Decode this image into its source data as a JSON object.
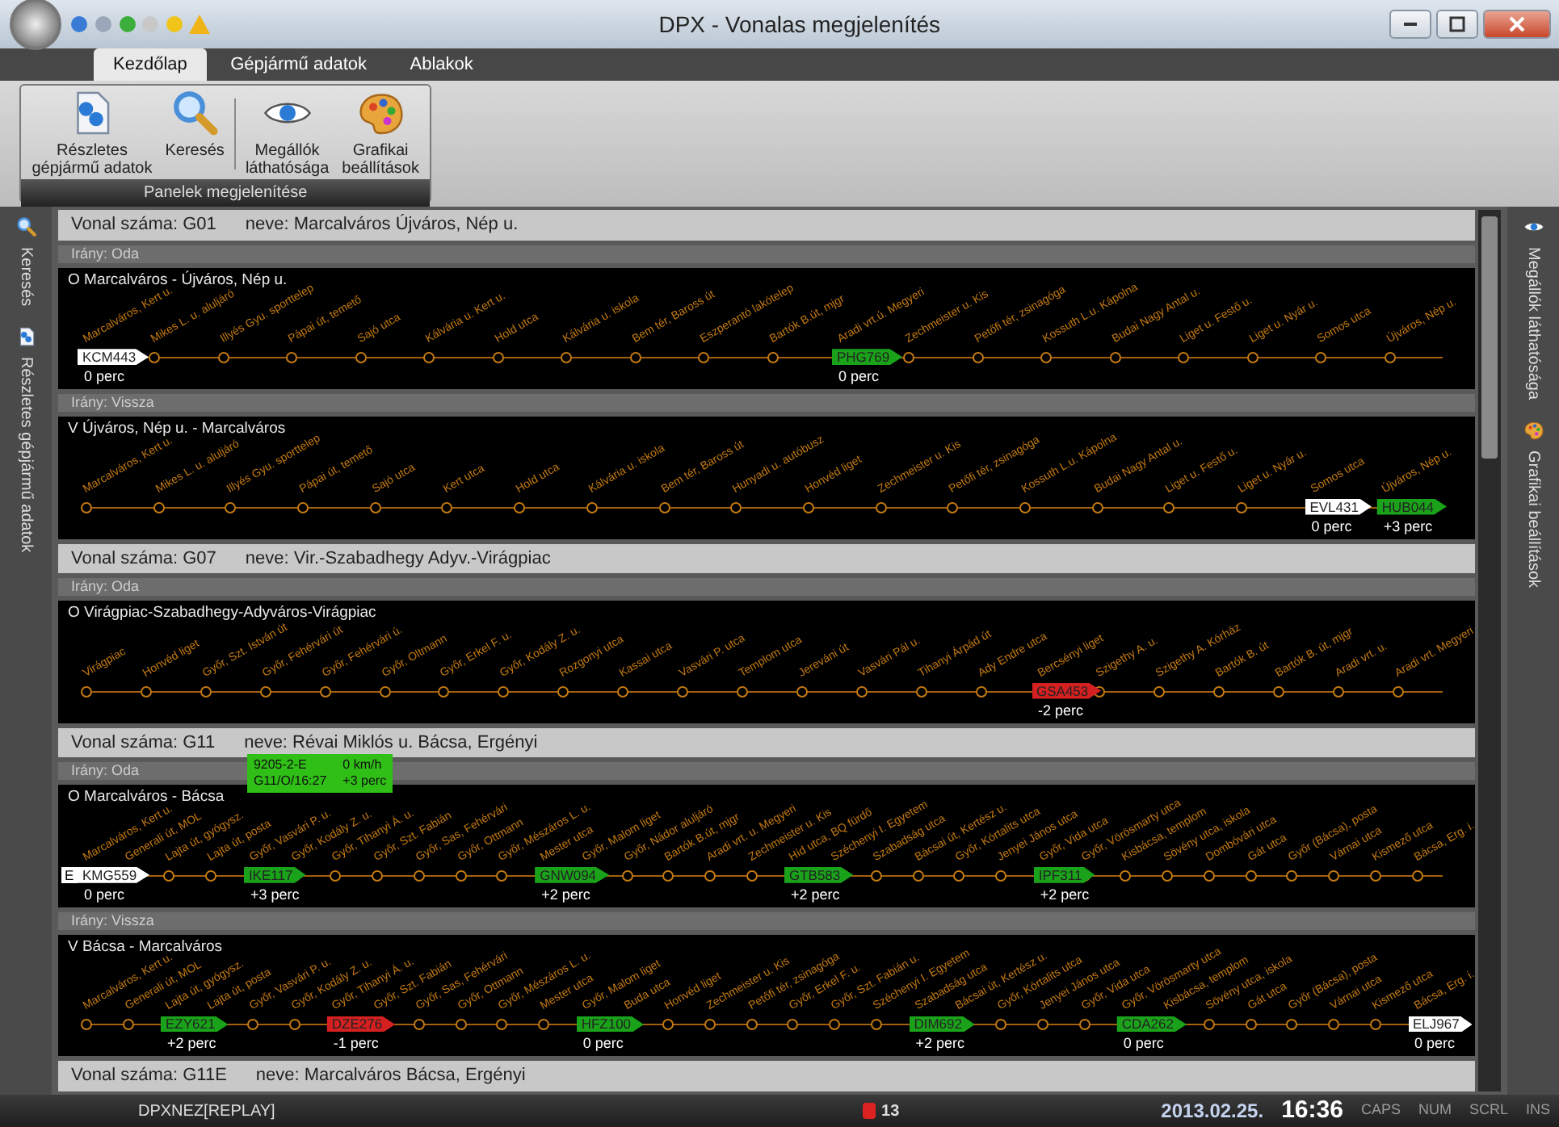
{
  "window": {
    "title": "DPX - Vonalas megjelenítés"
  },
  "ribbon": {
    "tabs": [
      {
        "label": "Kezdőlap",
        "selected": true
      },
      {
        "label": "Gépjármű adatok",
        "selected": false
      },
      {
        "label": "Ablakok",
        "selected": false
      }
    ],
    "buttons": [
      {
        "kind": "details",
        "label": "Részletes\ngépjármű adatok"
      },
      {
        "kind": "search",
        "label": "Keresés"
      },
      {
        "kind": "eye",
        "label": "Megállók\nláthatósága"
      },
      {
        "kind": "palette",
        "label": "Grafikai\nbeállítások"
      }
    ],
    "group_label": "Panelek megjelenítése"
  },
  "left_sidebar": [
    {
      "kind": "search",
      "label": "Keresés"
    },
    {
      "kind": "details",
      "label": "Részletes gépjármű adatok"
    }
  ],
  "right_sidebar": [
    {
      "kind": "eye",
      "label": "Megállók láthatósága"
    },
    {
      "kind": "palette",
      "label": "Grafikai beállítások"
    }
  ],
  "lines": [
    {
      "number": "Vonal száma: G01",
      "name": "neve: Marcalváros Újváros, Nép u.",
      "directions": [
        {
          "label": "Irány: Oda",
          "title": "O Marcalváros - Újváros, Nép u.",
          "stops": [
            {
              "name": "Marcalváros, Kert u.",
              "vehicle": {
                "plate": "KCM443",
                "color": "#ffffff",
                "delay": "0 perc"
              }
            },
            {
              "name": "Mikes L. u. aluljáró"
            },
            {
              "name": "Illyés Gyu. sporttelep"
            },
            {
              "name": "Pápai út, temető"
            },
            {
              "name": "Sajó utca"
            },
            {
              "name": "Kálvária u. Kert u."
            },
            {
              "name": "Hold utca"
            },
            {
              "name": "Kálvária u. iskola"
            },
            {
              "name": "Bem tér, Baross út"
            },
            {
              "name": "Eszperantó lakótelep"
            },
            {
              "name": "Bartók B.út, mjgr"
            },
            {
              "name": "Aradi vrt.ú. Megyeri",
              "vehicle": {
                "plate": "PHG769",
                "color": "#1aa31a",
                "delay": "0 perc"
              }
            },
            {
              "name": "Zechmeister u. Kis"
            },
            {
              "name": "Petőfi tér, zsinagóga"
            },
            {
              "name": "Kossuth L.u. Kápolna"
            },
            {
              "name": "Budai Nagy Antal u."
            },
            {
              "name": "Liget u. Festő u."
            },
            {
              "name": "Liget u. Nyár u."
            },
            {
              "name": "Somos utca"
            },
            {
              "name": "Újváros, Nép u."
            }
          ]
        },
        {
          "label": "Irány: Vissza",
          "title": "V Újváros, Nép u. - Marcalváros",
          "stops": [
            {
              "name": "Marcalváros, Kert u."
            },
            {
              "name": "Mikes L. u. aluljáró"
            },
            {
              "name": "Illyés Gyu. sporttelep"
            },
            {
              "name": "Pápai út, temető"
            },
            {
              "name": "Sajó utca"
            },
            {
              "name": "Kert utca"
            },
            {
              "name": "Hold utca"
            },
            {
              "name": "Kálvária u. iskola"
            },
            {
              "name": "Bem tér, Baross út"
            },
            {
              "name": "Hunyadi u. autóbusz"
            },
            {
              "name": "Honvéd liget"
            },
            {
              "name": "Zechmeister u. Kis"
            },
            {
              "name": "Petőfi tér, zsinagóga"
            },
            {
              "name": "Kossuth L.u. Kápolna"
            },
            {
              "name": "Budai Nagy Antal u."
            },
            {
              "name": "Liget u. Festő u."
            },
            {
              "name": "Liget u. Nyár u."
            },
            {
              "name": "Somos utca",
              "vehicle": {
                "plate": "EVL431",
                "color": "#ffffff",
                "delay": "0 perc"
              }
            },
            {
              "name": "Újváros, Nép u.",
              "vehicle": {
                "plate": "HUB044",
                "color": "#1aa31a",
                "delay": "+3 perc"
              }
            }
          ]
        }
      ]
    },
    {
      "number": "Vonal száma: G07",
      "name": "neve: Vir.-Szabadhegy Adyv.-Virágpiac",
      "directions": [
        {
          "label": "Irány: Oda",
          "title": "O Virágpiac-Szabadhegy-Adyváros-Virágpiac",
          "stops": [
            {
              "name": "Virágpiac"
            },
            {
              "name": "Honvéd liget"
            },
            {
              "name": "Győr, Szt. István út"
            },
            {
              "name": "Győr, Fehérvári út"
            },
            {
              "name": "Győr, Fehérvári ú."
            },
            {
              "name": "Győr, Oltmann"
            },
            {
              "name": "Győr, Erkel F. u."
            },
            {
              "name": "Győr, Kodály Z. u."
            },
            {
              "name": "Rozgonyi utca"
            },
            {
              "name": "Kassai utca"
            },
            {
              "name": "Vasvári P. utca"
            },
            {
              "name": "Templom utca"
            },
            {
              "name": "Jereváni út"
            },
            {
              "name": "Vasvári Pál u."
            },
            {
              "name": "Tihanyi Árpád út"
            },
            {
              "name": "Ady Endre utca"
            },
            {
              "name": "Bercsényi liget",
              "vehicle": {
                "plate": "GSA453",
                "color": "#d42020",
                "delay": "-2 perc"
              }
            },
            {
              "name": "Szigethy A. u."
            },
            {
              "name": "Szigethy A. Kórház"
            },
            {
              "name": "Bartók B. út"
            },
            {
              "name": "Bartók B. út, mjgr"
            },
            {
              "name": "Aradi vrt. u."
            },
            {
              "name": "Aradi vrt. Megyeri"
            }
          ]
        }
      ]
    },
    {
      "number": "Vonal száma: G11",
      "name": "neve: Révai Miklós u. Bácsa, Ergényi",
      "directions": [
        {
          "label": "Irány: Oda",
          "title": "O Marcalváros - Bácsa",
          "stops": [
            {
              "name": "Marcalváros, Kert u.",
              "vehicle": {
                "prefix": "E",
                "plate": "KMG559",
                "color": "#ffffff",
                "delay": "0 perc"
              }
            },
            {
              "name": "Generali út, MOL"
            },
            {
              "name": "Lajta út, gyógysz."
            },
            {
              "name": "Lajta út, posta"
            },
            {
              "name": "Győr, Vasvári P. u.",
              "vehicle": {
                "plate": "IKE117",
                "color": "#1aa31a",
                "delay": "+3 perc",
                "popup": [
                  "9205-2-E",
                  "G11/O/16:27",
                  "0 km/h",
                  "+3 perc"
                ]
              }
            },
            {
              "name": "Győr, Kodály Z. u."
            },
            {
              "name": "Győr, Tihanyi Á. u."
            },
            {
              "name": "Győr, Szt. Fabián"
            },
            {
              "name": "Győr, Sas, Fehérvári"
            },
            {
              "name": "Győr, Ottmann"
            },
            {
              "name": "Győr, Mészáros L. u."
            },
            {
              "name": "Mester utca",
              "vehicle": {
                "plate": "GNW094",
                "color": "#1aa31a",
                "delay": "+2 perc"
              }
            },
            {
              "name": "Győr, Malom liget"
            },
            {
              "name": "Győr, Nádor aluljáró"
            },
            {
              "name": "Bartók B.út, mjgr"
            },
            {
              "name": "Aradi vrt. u. Megyeri"
            },
            {
              "name": "Zechmeister u. Kis"
            },
            {
              "name": "Híd utca, BQ fürdő",
              "vehicle": {
                "plate": "GTB583",
                "color": "#1aa31a",
                "delay": "+2 perc"
              }
            },
            {
              "name": "Széchenyi I. Egyetem"
            },
            {
              "name": "Szabadság utca"
            },
            {
              "name": "Bácsai út, Kertész u."
            },
            {
              "name": "Győr, Kórtalits utca"
            },
            {
              "name": "Jenyei János utca"
            },
            {
              "name": "Győr, Vida utca",
              "vehicle": {
                "plate": "IPF311",
                "color": "#1aa31a",
                "delay": "+2 perc"
              }
            },
            {
              "name": "Győr, Vörösmarty utca"
            },
            {
              "name": "Kisbácsa, templom"
            },
            {
              "name": "Sövény utca, iskola"
            },
            {
              "name": "Dombóvári utca"
            },
            {
              "name": "Gát utca"
            },
            {
              "name": "Győr (Bácsa), posta"
            },
            {
              "name": "Várnai utca"
            },
            {
              "name": "Kismező utca"
            },
            {
              "name": "Bácsa, Erg. i."
            }
          ]
        },
        {
          "label": "Irány: Vissza",
          "title": "V Bácsa - Marcalváros",
          "stops": [
            {
              "name": "Marcalváros, Kert u."
            },
            {
              "name": "Generali út, MOL"
            },
            {
              "name": "Lajta út, gyógysz.",
              "vehicle": {
                "plate": "EZY621",
                "color": "#1aa31a",
                "delay": "+2 perc"
              }
            },
            {
              "name": "Lajta út, posta"
            },
            {
              "name": "Győr, Vasvári P. u."
            },
            {
              "name": "Győr, Kodály Z. u."
            },
            {
              "name": "Győr, Tihanyi Á. u.",
              "vehicle": {
                "plate": "DZE276",
                "color": "#d42020",
                "delay": "-1 perc"
              }
            },
            {
              "name": "Győr, Szt. Fabián"
            },
            {
              "name": "Győr, Sas, Fehérvári"
            },
            {
              "name": "Győr, Ottmann"
            },
            {
              "name": "Győr, Mészáros L. u."
            },
            {
              "name": "Mester utca"
            },
            {
              "name": "Győr, Malom liget",
              "vehicle": {
                "plate": "HFZ100",
                "color": "#1aa31a",
                "delay": "0 perc"
              }
            },
            {
              "name": "Buda utca"
            },
            {
              "name": "Honvéd liget"
            },
            {
              "name": "Zechmeister u. Kis"
            },
            {
              "name": "Petőfi tér, zsinagóga"
            },
            {
              "name": "Győr, Erkel F. u."
            },
            {
              "name": "Győr, Szt. Fabián u."
            },
            {
              "name": "Széchenyi I. Egyetem"
            },
            {
              "name": "Szabadság utca",
              "vehicle": {
                "plate": "DIM692",
                "color": "#1aa31a",
                "delay": "+2 perc"
              }
            },
            {
              "name": "Bácsai út, Kertész u."
            },
            {
              "name": "Győr, Kórtalits utca"
            },
            {
              "name": "Jenyei János utca"
            },
            {
              "name": "Győr, Vida utca"
            },
            {
              "name": "Győr, Vörösmarty utca",
              "vehicle": {
                "plate": "CDA262",
                "color": "#1aa31a",
                "delay": "0 perc"
              }
            },
            {
              "name": "Kisbácsa, templom"
            },
            {
              "name": "Sövény utca, iskola"
            },
            {
              "name": "Gát utca"
            },
            {
              "name": "Győr (Bácsa), posta"
            },
            {
              "name": "Várnai utca"
            },
            {
              "name": "Kismező utca"
            },
            {
              "name": "Bácsa, Erg. i.",
              "vehicle": {
                "plate": "ELJ967",
                "color": "#ffffff",
                "delay": "0 perc"
              }
            }
          ]
        }
      ]
    },
    {
      "number": "Vonal száma: G11E",
      "name": "neve: Marcalváros Bácsa, Ergényi"
    }
  ],
  "status_bar": {
    "session": "DPXNEZ[REPLAY]",
    "alerts": "13",
    "date": "2013.02.25.",
    "time": "16:36",
    "indicators": [
      "CAPS",
      "NUM",
      "SCRL",
      "INS"
    ]
  }
}
